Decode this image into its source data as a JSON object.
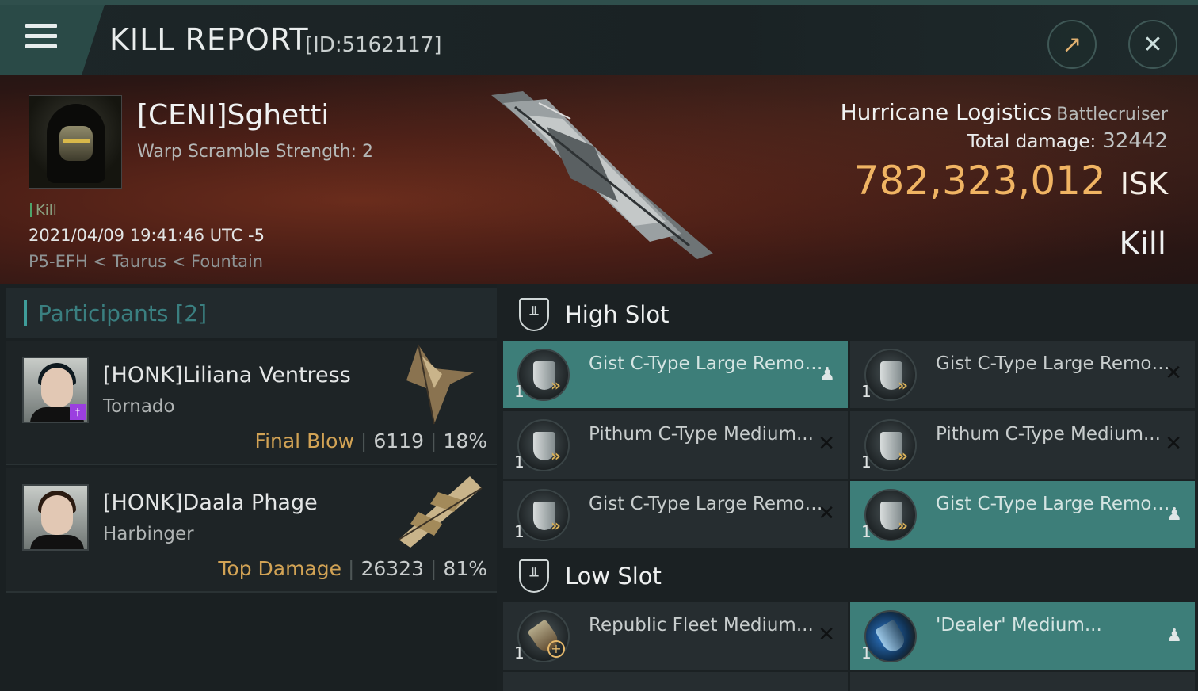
{
  "header": {
    "title": "KILL REPORT",
    "report_id": "[ID:5162117]",
    "menu_icon": "hamburger-menu-icon",
    "share_icon": "share-external-icon",
    "close_icon": "close-x-icon"
  },
  "victim": {
    "name": "[CENI]Sghetti",
    "warp_scramble": "Warp Scramble Strength: 2",
    "kill_type": "Kill",
    "datetime": "2021/04/09 19:41:46 UTC -5",
    "location": "P5-EFH < Taurus < Fountain",
    "ship_name": "Hurricane Logistics",
    "ship_class": "Battlecruiser",
    "total_damage_label": "Total damage:",
    "total_damage_value": "32442",
    "isk_value": "782,323,012",
    "isk_unit": "ISK",
    "result": "Kill"
  },
  "participants": {
    "header": "Participants [2]",
    "list": [
      {
        "name": "[HONK]Liliana Ventress",
        "ship": "Tornado",
        "role": "Final Blow",
        "damage": "6119",
        "percent": "18%"
      },
      {
        "name": "[HONK]Daala Phage",
        "ship": "Harbinger",
        "role": "Top Damage",
        "damage": "26323",
        "percent": "81%"
      }
    ]
  },
  "fitting": {
    "high_slot_label": "High Slot",
    "low_slot_label": "Low Slot",
    "high_slot": [
      {
        "name": "Gist C-Type Large Remote...",
        "qty": "1",
        "status": "dropped"
      },
      {
        "name": "Gist C-Type Large Remote...",
        "qty": "1",
        "status": "destroyed"
      },
      {
        "name": "Pithum C-Type Medium...",
        "qty": "1",
        "status": "destroyed"
      },
      {
        "name": "Pithum C-Type Medium...",
        "qty": "1",
        "status": "destroyed"
      },
      {
        "name": "Gist C-Type Large Remote...",
        "qty": "1",
        "status": "destroyed"
      },
      {
        "name": "Gist C-Type Large Remote...",
        "qty": "1",
        "status": "dropped"
      }
    ],
    "low_slot": [
      {
        "name": "Republic Fleet Medium...",
        "qty": "1",
        "status": "destroyed"
      },
      {
        "name": "'Dealer' Medium...",
        "qty": "1",
        "status": "dropped"
      }
    ]
  },
  "colors": {
    "accent_teal": "#3d7e79",
    "isk_gold": "#f0b463",
    "role_gold": "#d2a355"
  }
}
